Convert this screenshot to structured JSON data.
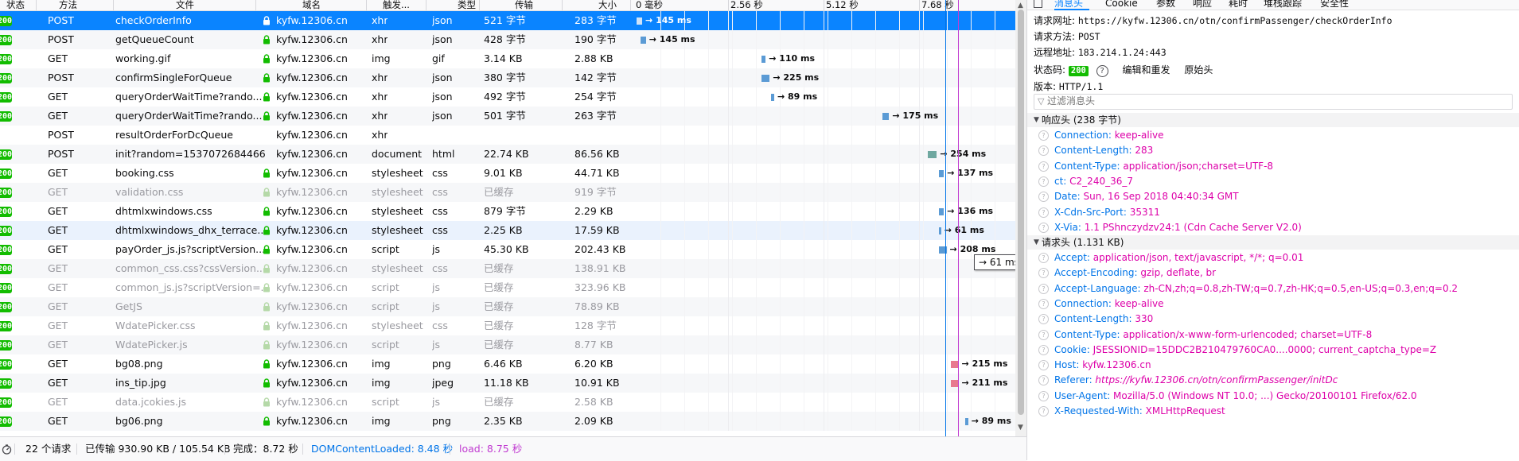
{
  "columns": [
    "状态",
    "方法",
    "文件",
    "域名",
    "触发...",
    "类型",
    "传输",
    "大小"
  ],
  "timeline_ticks": [
    "0 毫秒",
    "2.56 秒",
    "5.12 秒",
    "7.68 秒"
  ],
  "requests": [
    {
      "status": "200",
      "method": "POST",
      "file": "checkOrderInfo",
      "domain": "kyfw.12306.cn",
      "cause": "xhr",
      "type": "json",
      "transferred": "521 字节",
      "size": "283 字节",
      "timing": "→ 145 ms",
      "wf_start": 0.0,
      "wf_dur": 0.15,
      "lock": true,
      "selected": true
    },
    {
      "status": "200",
      "method": "POST",
      "file": "getQueueCount",
      "domain": "kyfw.12306.cn",
      "cause": "xhr",
      "type": "json",
      "transferred": "428 字节",
      "size": "190 字节",
      "timing": "→ 145 ms",
      "wf_start": 0.1,
      "wf_dur": 0.15,
      "lock": true
    },
    {
      "status": "200",
      "method": "GET",
      "file": "working.gif",
      "domain": "kyfw.12306.cn",
      "cause": "img",
      "type": "gif",
      "transferred": "3.14 KB",
      "size": "2.88 KB",
      "timing": "→ 110 ms",
      "wf_start": 3.35,
      "wf_dur": 0.11,
      "lock": true
    },
    {
      "status": "200",
      "method": "POST",
      "file": "confirmSingleForQueue",
      "domain": "kyfw.12306.cn",
      "cause": "xhr",
      "type": "json",
      "transferred": "380 字节",
      "size": "142 字节",
      "timing": "→ 225 ms",
      "wf_start": 3.35,
      "wf_dur": 0.22,
      "lock": true
    },
    {
      "status": "200",
      "method": "GET",
      "file": "queryOrderWaitTime?rando...",
      "domain": "kyfw.12306.cn",
      "cause": "xhr",
      "type": "json",
      "transferred": "492 字节",
      "size": "254 字节",
      "timing": "→ 89 ms",
      "wf_start": 3.6,
      "wf_dur": 0.09,
      "lock": true
    },
    {
      "status": "200",
      "method": "GET",
      "file": "queryOrderWaitTime?rando...",
      "domain": "kyfw.12306.cn",
      "cause": "xhr",
      "type": "json",
      "transferred": "501 字节",
      "size": "263 字节",
      "timing": "→ 175 ms",
      "wf_start": 6.6,
      "wf_dur": 0.17,
      "lock": true
    },
    {
      "status": "",
      "method": "POST",
      "file": "resultOrderForDcQueue",
      "domain": "kyfw.12306.cn",
      "cause": "xhr",
      "type": "",
      "transferred": "",
      "size": "",
      "timing": "",
      "wf_start": null,
      "wf_dur": null,
      "lock": false
    },
    {
      "status": "200",
      "method": "POST",
      "file": "init?random=1537072684466",
      "domain": "kyfw.12306.cn",
      "cause": "document",
      "type": "html",
      "transferred": "22.74 KB",
      "size": "86.56 KB",
      "timing": "→ 254 ms",
      "wf_start": 7.8,
      "wf_dur": 0.25,
      "lock": false
    },
    {
      "status": "200",
      "method": "GET",
      "file": "booking.css",
      "domain": "kyfw.12306.cn",
      "cause": "stylesheet",
      "type": "css",
      "transferred": "9.01 KB",
      "size": "44.71 KB",
      "timing": "→ 137 ms",
      "wf_start": 8.1,
      "wf_dur": 0.14,
      "lock": true
    },
    {
      "status": "200",
      "method": "GET",
      "file": "validation.css",
      "domain": "kyfw.12306.cn",
      "cause": "stylesheet",
      "type": "css",
      "transferred": "已缓存",
      "size": "919 字节",
      "timing": "",
      "wf_start": null,
      "wf_dur": null,
      "lock": true,
      "cached": true
    },
    {
      "status": "200",
      "method": "GET",
      "file": "dhtmlxwindows.css",
      "domain": "kyfw.12306.cn",
      "cause": "stylesheet",
      "type": "css",
      "transferred": "879 字节",
      "size": "2.29 KB",
      "timing": "→ 136 ms",
      "wf_start": 8.1,
      "wf_dur": 0.14,
      "lock": true
    },
    {
      "status": "200",
      "method": "GET",
      "file": "dhtmlxwindows_dhx_terrace....",
      "domain": "kyfw.12306.cn",
      "cause": "stylesheet",
      "type": "css",
      "transferred": "2.25 KB",
      "size": "17.59 KB",
      "timing": "→ 61 ms",
      "wf_start": 8.1,
      "wf_dur": 0.06,
      "lock": true,
      "hover": true
    },
    {
      "status": "200",
      "method": "GET",
      "file": "payOrder_js.js?scriptVersion...",
      "domain": "kyfw.12306.cn",
      "cause": "script",
      "type": "js",
      "transferred": "45.30 KB",
      "size": "202.43 KB",
      "timing": "→ 208 ms",
      "wf_start": 8.1,
      "wf_dur": 0.21,
      "lock": true
    },
    {
      "status": "200",
      "method": "GET",
      "file": "common_css.css?cssVersion...",
      "domain": "kyfw.12306.cn",
      "cause": "stylesheet",
      "type": "css",
      "transferred": "已缓存",
      "size": "138.91 KB",
      "timing": "",
      "wf_start": null,
      "wf_dur": null,
      "lock": true,
      "cached": true
    },
    {
      "status": "200",
      "method": "GET",
      "file": "common_js.js?scriptVersion=...",
      "domain": "kyfw.12306.cn",
      "cause": "script",
      "type": "js",
      "transferred": "已缓存",
      "size": "323.96 KB",
      "timing": "",
      "wf_start": null,
      "wf_dur": null,
      "lock": true,
      "cached": true
    },
    {
      "status": "200",
      "method": "GET",
      "file": "GetJS",
      "domain": "kyfw.12306.cn",
      "cause": "script",
      "type": "js",
      "transferred": "已缓存",
      "size": "78.89 KB",
      "timing": "",
      "wf_start": null,
      "wf_dur": null,
      "lock": true,
      "cached": true
    },
    {
      "status": "200",
      "method": "GET",
      "file": "WdatePicker.css",
      "domain": "kyfw.12306.cn",
      "cause": "stylesheet",
      "type": "css",
      "transferred": "已缓存",
      "size": "128 字节",
      "timing": "",
      "wf_start": null,
      "wf_dur": null,
      "lock": true,
      "cached": true
    },
    {
      "status": "200",
      "method": "GET",
      "file": "WdatePicker.js",
      "domain": "kyfw.12306.cn",
      "cause": "script",
      "type": "js",
      "transferred": "已缓存",
      "size": "8.77 KB",
      "timing": "",
      "wf_start": null,
      "wf_dur": null,
      "lock": true,
      "cached": true
    },
    {
      "status": "200",
      "method": "GET",
      "file": "bg08.png",
      "domain": "kyfw.12306.cn",
      "cause": "img",
      "type": "png",
      "transferred": "6.46 KB",
      "size": "6.20 KB",
      "timing": "→ 215 ms",
      "wf_start": 8.42,
      "wf_dur": 0.21,
      "lock": true,
      "pink": true
    },
    {
      "status": "200",
      "method": "GET",
      "file": "ins_tip.jpg",
      "domain": "kyfw.12306.cn",
      "cause": "img",
      "type": "jpeg",
      "transferred": "11.18 KB",
      "size": "10.91 KB",
      "timing": "→ 211 ms",
      "wf_start": 8.42,
      "wf_dur": 0.21,
      "lock": true,
      "pink": true
    },
    {
      "status": "200",
      "method": "GET",
      "file": "data.jcokies.js",
      "domain": "kyfw.12306.cn",
      "cause": "script",
      "type": "js",
      "transferred": "已缓存",
      "size": "2.58 KB",
      "timing": "",
      "wf_start": null,
      "wf_dur": null,
      "lock": true,
      "cached": true
    },
    {
      "status": "200",
      "method": "GET",
      "file": "bg06.png",
      "domain": "kyfw.12306.cn",
      "cause": "img",
      "type": "png",
      "transferred": "2.35 KB",
      "size": "2.09 KB",
      "timing": "→ 89 ms",
      "wf_start": 8.8,
      "wf_dur": 0.09,
      "lock": true
    }
  ],
  "tooltip": "→ 61 ms",
  "markers": {
    "dom_content_loaded_s": 8.48,
    "load_s": 8.75
  },
  "status_bar": {
    "requests": "22 个请求",
    "transferred": "已传输 930.90 KB / 105.54 KB",
    "finish": "完成：8.72 秒",
    "dom": "DOMContentLoaded: 8.48 秒",
    "load": "load: 8.75 秒"
  },
  "details": {
    "tabs": [
      "消息头",
      "Cookie",
      "参数",
      "响应",
      "耗时",
      "堆栈跟踪",
      "安全性"
    ],
    "request_url_label": "请求网址:",
    "request_url": "https://kyfw.12306.cn/otn/confirmPassenger/checkOrderInfo",
    "method_label": "请求方法:",
    "method": "POST",
    "remote_label": "远程地址:",
    "remote": "183.214.1.24:443",
    "status_label": "状态码:",
    "status_code": "200",
    "edit_resend": "编辑和重发",
    "raw_headers": "原始头",
    "version_label": "版本:",
    "version": "HTTP/1.1",
    "filter_placeholder": "过滤消息头",
    "response_headers_title": "响应头 (238 字节)",
    "response_headers": [
      {
        "name": "Connection:",
        "value": "keep-alive"
      },
      {
        "name": "Content-Length:",
        "value": "283"
      },
      {
        "name": "Content-Type:",
        "value": "application/json;charset=UTF-8"
      },
      {
        "name": "ct:",
        "value": "C2_240_36_7"
      },
      {
        "name": "Date:",
        "value": "Sun, 16 Sep 2018 04:40:34 GMT"
      },
      {
        "name": "X-Cdn-Src-Port:",
        "value": "35311"
      },
      {
        "name": "X-Via:",
        "value": "1.1 PShnczydzv24:1 (Cdn Cache Server V2.0)"
      }
    ],
    "request_headers_title": "请求头 (1.131 KB)",
    "request_headers": [
      {
        "name": "Accept:",
        "value": "application/json, text/javascript, */*; q=0.01"
      },
      {
        "name": "Accept-Encoding:",
        "value": "gzip, deflate, br"
      },
      {
        "name": "Accept-Language:",
        "value": "zh-CN,zh;q=0.8,zh-TW;q=0.7,zh-HK;q=0.5,en-US;q=0.3,en;q=0.2"
      },
      {
        "name": "Connection:",
        "value": "keep-alive"
      },
      {
        "name": "Content-Length:",
        "value": "330"
      },
      {
        "name": "Content-Type:",
        "value": "application/x-www-form-urlencoded; charset=UTF-8"
      },
      {
        "name": "Cookie:",
        "value": "JSESSIONID=15DDC2B210479760CA0....0000; current_captcha_type=Z"
      },
      {
        "name": "Host:",
        "value": "kyfw.12306.cn"
      },
      {
        "name": "Referer:",
        "value": "https://kyfw.12306.cn/otn/confirmPassenger/initDc",
        "italic": true
      },
      {
        "name": "User-Agent:",
        "value": "Mozilla/5.0 (Windows NT 10.0; ...) Gecko/20100101 Firefox/62.0"
      },
      {
        "name": "X-Requested-With:",
        "value": "XMLHttpRequest"
      }
    ]
  },
  "colors": {
    "selected": "#0a84ff",
    "status_ok": "#12bc00",
    "dom_line": "#0074e8",
    "load_line": "#c13cd1",
    "wf_bar": "#5b9bd5",
    "wf_bar_doc": "#6fa8a0",
    "wf_bar_pink": "#e8798f",
    "header_value": "#dd00a9",
    "header_name": "#0074e8"
  }
}
